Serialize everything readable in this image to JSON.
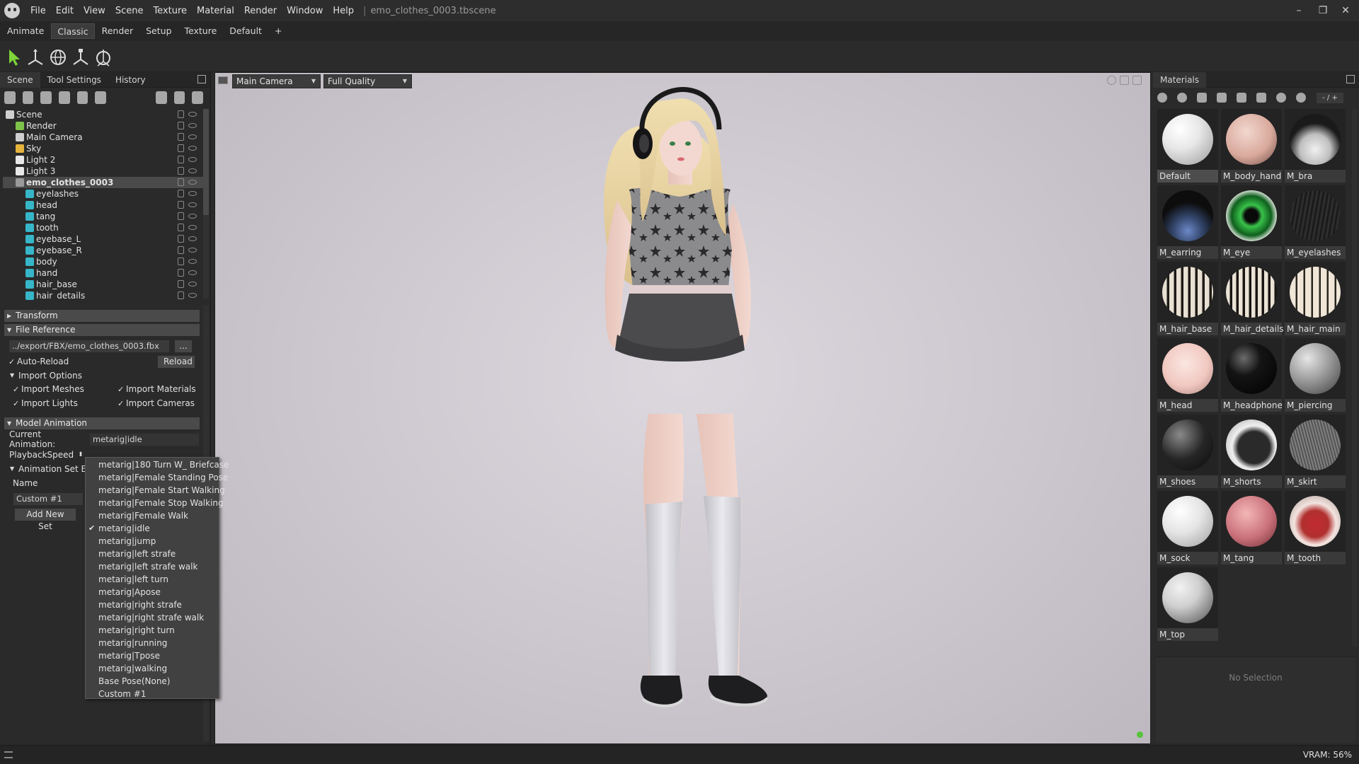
{
  "app": {
    "menu": [
      "File",
      "Edit",
      "View",
      "Scene",
      "Texture",
      "Material",
      "Render",
      "Window",
      "Help"
    ],
    "document_title": "emo_clothes_0003.tbscene"
  },
  "workspace_tabs": [
    "Animate",
    "Classic",
    "Render",
    "Setup",
    "Texture",
    "Default",
    "+"
  ],
  "left_panel": {
    "tabs": [
      "Scene",
      "Tool Settings",
      "History"
    ],
    "tree": [
      {
        "label": "Scene",
        "icon": "scene-icon",
        "color": "#cfcfcf",
        "depth": 0
      },
      {
        "label": "Render",
        "icon": "render-icon",
        "color": "#7fc24a",
        "depth": 1
      },
      {
        "label": "Main Camera",
        "icon": "camera-icon",
        "color": "#cfcfcf",
        "depth": 1
      },
      {
        "label": "Sky",
        "icon": "sky-icon",
        "color": "#e6b33c",
        "depth": 1
      },
      {
        "label": "Light 2",
        "icon": "light-icon",
        "color": "#e8e8e8",
        "depth": 1
      },
      {
        "label": "Light 3",
        "icon": "light-icon",
        "color": "#e8e8e8",
        "depth": 1
      },
      {
        "label": "emo_clothes_0003",
        "icon": "model-icon",
        "color": "#9a9a9a",
        "depth": 1,
        "selected": true
      },
      {
        "label": "eyelashes",
        "icon": "mesh-icon",
        "color": "#36b6c8",
        "depth": 2
      },
      {
        "label": "head",
        "icon": "mesh-icon",
        "color": "#36b6c8",
        "depth": 2
      },
      {
        "label": "tang",
        "icon": "mesh-icon",
        "color": "#36b6c8",
        "depth": 2
      },
      {
        "label": "tooth",
        "icon": "mesh-icon",
        "color": "#36b6c8",
        "depth": 2
      },
      {
        "label": "eyebase_L",
        "icon": "mesh-icon",
        "color": "#36b6c8",
        "depth": 2
      },
      {
        "label": "eyebase_R",
        "icon": "mesh-icon",
        "color": "#36b6c8",
        "depth": 2
      },
      {
        "label": "body",
        "icon": "mesh-icon",
        "color": "#36b6c8",
        "depth": 2
      },
      {
        "label": "hand",
        "icon": "mesh-icon",
        "color": "#36b6c8",
        "depth": 2
      },
      {
        "label": "hair_base",
        "icon": "mesh-icon",
        "color": "#36b6c8",
        "depth": 2
      },
      {
        "label": "hair_details",
        "icon": "mesh-icon",
        "color": "#36b6c8",
        "depth": 2
      }
    ],
    "transform_label": "Transform",
    "file_reference": {
      "header": "File Reference",
      "path": "../export/FBX/emo_clothes_0003.fbx",
      "browse_label": "...",
      "auto_reload_label": "Auto-Reload",
      "reload_label": "Reload",
      "import_options_label": "Import Options",
      "import_meshes": "Import Meshes",
      "import_materials": "Import Materials",
      "import_lights": "Import Lights",
      "import_cameras": "Import Cameras"
    },
    "model_animation": {
      "header": "Model Animation",
      "current_animation_label": "Current Animation:",
      "current_animation_value": "metarig|idle",
      "playback_speed_label": "PlaybackSpeed",
      "animation_set_label": "Animation Set Ed",
      "name_label": "Name",
      "custom_value": "Custom #1",
      "add_new_set_label": "Add New Set"
    },
    "animation_options": [
      "metarig|180 Turn W_ Briefcase",
      "metarig|Female Standing Pose",
      "metarig|Female Start Walking",
      "metarig|Female Stop Walking",
      "metarig|Female Walk",
      "metarig|idle",
      "metarig|jump",
      "metarig|left strafe",
      "metarig|left strafe walk",
      "metarig|left turn",
      "metarig|Apose",
      "metarig|right strafe",
      "metarig|right strafe walk",
      "metarig|right turn",
      "metarig|running",
      "metarig|Tpose",
      "metarig|walking",
      "Base Pose(None)",
      "Custom #1"
    ],
    "selected_animation": "metarig|idle"
  },
  "viewport": {
    "camera": "Main Camera",
    "quality": "Full Quality"
  },
  "right_panel": {
    "title": "Materials",
    "page_indicator": "- / +",
    "materials": [
      {
        "name": "Default",
        "style": "radial-gradient(circle at 35% 30%, #ffffff 0%, #e8e8e8 40%, #9a9a9a 100%)",
        "selected": true
      },
      {
        "name": "M_body_hand",
        "style": "radial-gradient(circle at 40% 35%, #f2d7cf 0%, #d9a99c 55%, #6b4a44 100%)"
      },
      {
        "name": "M_bra",
        "style": "radial-gradient(circle at 50% 70%, #f0f0f0 0%, #bfbfbf 35%, #1a1a1a 60%)"
      },
      {
        "name": "M_earring",
        "style": "radial-gradient(circle at 50% 80%, #6c88c8 0%, #33466b 30%, #0d0d0d 60%)"
      },
      {
        "name": "M_eye",
        "style": "radial-gradient(circle at 50% 50%, #0a0a0a 0%, #0a0a0a 18%, #39c24a 30%, #0f5f1d 55%, #dfe8de 72%, #9aa39a 100%)"
      },
      {
        "name": "M_eyelashes",
        "style": "repeating-linear-gradient(100deg, #1b1b1b 0px, #333 3px, #111 6px)"
      },
      {
        "name": "M_hair_base",
        "style": "repeating-linear-gradient(90deg, #e8e0d2 0px, #e8e0d2 6px, #1e1a16 7px, #1e1a16 10px)"
      },
      {
        "name": "M_hair_details",
        "style": "repeating-linear-gradient(90deg, #ebe3d6 0px, #ebe3d6 5px, #1a1612 6px, #1a1612 9px)"
      },
      {
        "name": "M_hair_main",
        "style": "repeating-linear-gradient(90deg, #efe6d8 0px, #efe6d8 8px, #2a241d 9px, #2a241d 11px)"
      },
      {
        "name": "M_head",
        "style": "radial-gradient(circle at 45% 40%, #fbe6e2 0%, #f0c8c0 55%, #a98079 100%)"
      },
      {
        "name": "M_headphone",
        "style": "radial-gradient(circle at 35% 30%, #6b6b6b 0%, #141414 35%, #000 100%)"
      },
      {
        "name": "M_piercing",
        "style": "radial-gradient(circle at 35% 30%, #e6e6e6 0%, #9c9c9c 45%, #3d3d3d 100%)"
      },
      {
        "name": "M_shoes",
        "style": "radial-gradient(circle at 35% 30%, #8a8a8a 0%, #262626 50%, #0b0b0b 100%)"
      },
      {
        "name": "M_shorts",
        "style": "radial-gradient(circle at 55% 55%, #2a2a2a 0%, #2a2a2a 40%, #f0f0f0 55%, #9e9e9e 100%)"
      },
      {
        "name": "M_skirt",
        "style": "repeating-linear-gradient(75deg, #5a5a5a 0px, #8a8a8a 2px, #3a3a3a 4px)"
      },
      {
        "name": "M_sock",
        "style": "radial-gradient(circle at 35% 30%, #ffffff 0%, #e4e4e4 45%, #9d9d9d 100%)"
      },
      {
        "name": "M_tang",
        "style": "radial-gradient(circle at 40% 35%, #f3b7b5 0%, #c9707a 55%, #6a2a32 100%)"
      },
      {
        "name": "M_tooth",
        "style": "radial-gradient(circle at 50% 55%, #c22a32 0%, #b0302f 35%, #f3e4e0 55%, #a1928e 100%)"
      },
      {
        "name": "M_top",
        "style": "radial-gradient(circle at 35% 30%, #f2f2f2 0%, #cfcfcf 40%, #4d4d4d 100%)"
      }
    ],
    "no_selection_text": "No Selection"
  },
  "status": {
    "vram": "VRAM: 56%"
  }
}
